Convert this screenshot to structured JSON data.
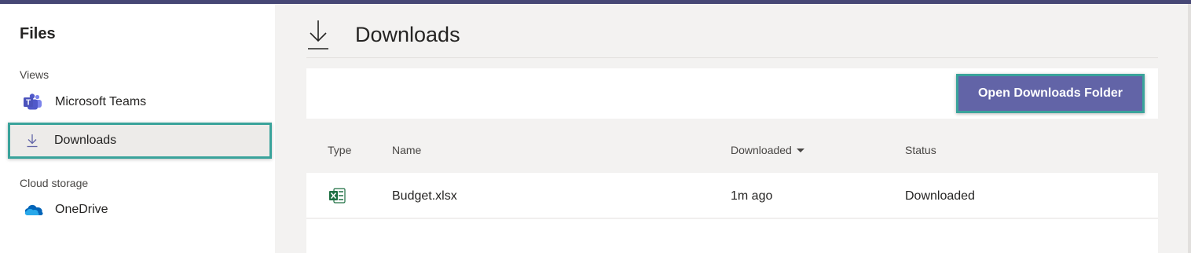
{
  "sidebar": {
    "title": "Files",
    "views_label": "Views",
    "views": [
      {
        "label": "Microsoft Teams",
        "icon": "teams-icon"
      },
      {
        "label": "Downloads",
        "icon": "download-arrow-icon"
      }
    ],
    "cloud_label": "Cloud storage",
    "cloud": [
      {
        "label": "OneDrive",
        "icon": "onedrive-cloud-icon"
      }
    ]
  },
  "main": {
    "title": "Downloads",
    "title_icon": "download-arrow-icon",
    "open_button_label": "Open Downloads Folder",
    "columns": [
      "Type",
      "Name",
      "Downloaded",
      "Status"
    ],
    "sorted_column": "Downloaded",
    "rows": [
      {
        "type_icon": "excel-icon",
        "name": "Budget.xlsx",
        "downloaded": "1m ago",
        "status": "Downloaded"
      }
    ]
  },
  "colors": {
    "accent": "#6264a7",
    "topbar": "#464775",
    "highlight": "#3aa39b",
    "excel": "#1d6f42",
    "onedrive": "#0364b8"
  }
}
